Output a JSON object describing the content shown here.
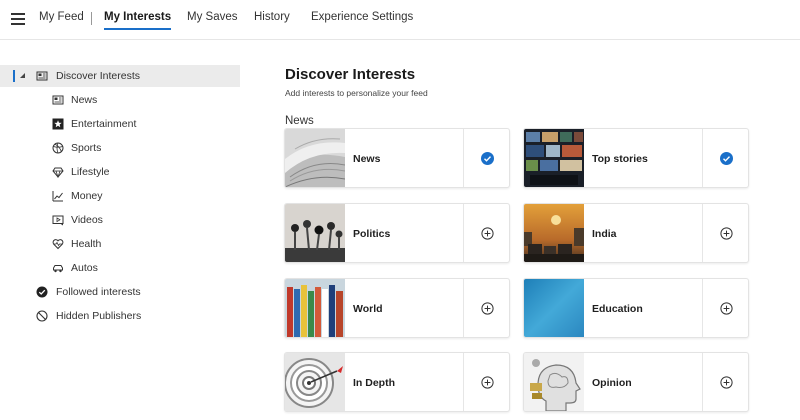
{
  "topnav": {
    "items": [
      {
        "label": "My Feed",
        "active": false
      },
      {
        "label": "My Interests",
        "active": true
      },
      {
        "label": "My Saves",
        "active": false
      },
      {
        "label": "History",
        "active": false
      },
      {
        "label": "Experience Settings",
        "active": false
      }
    ]
  },
  "sidebar": {
    "root": {
      "label": "Discover Interests",
      "icon": "newspaper-icon",
      "selected": true
    },
    "children": [
      {
        "label": "News",
        "icon": "newspaper-icon"
      },
      {
        "label": "Entertainment",
        "icon": "star-icon"
      },
      {
        "label": "Sports",
        "icon": "basketball-icon"
      },
      {
        "label": "Lifestyle",
        "icon": "diamond-icon"
      },
      {
        "label": "Money",
        "icon": "chart-icon"
      },
      {
        "label": "Videos",
        "icon": "video-icon"
      },
      {
        "label": "Health",
        "icon": "heart-icon"
      },
      {
        "label": "Autos",
        "icon": "car-icon"
      }
    ],
    "followed": {
      "label": "Followed interests",
      "icon": "check-circle-icon"
    },
    "hidden": {
      "label": "Hidden Publishers",
      "icon": "block-icon"
    }
  },
  "main": {
    "title": "Discover Interests",
    "subtitle": "Add interests to personalize your feed",
    "section": "News",
    "cards": [
      {
        "label": "News",
        "followed": true,
        "thumb": "newspapers"
      },
      {
        "label": "Top stories",
        "followed": true,
        "thumb": "screens"
      },
      {
        "label": "Politics",
        "followed": false,
        "thumb": "microphones"
      },
      {
        "label": "India",
        "followed": false,
        "thumb": "traffic"
      },
      {
        "label": "World",
        "followed": false,
        "thumb": "flags"
      },
      {
        "label": "Education",
        "followed": false,
        "thumb": "blue"
      },
      {
        "label": "In Depth",
        "followed": false,
        "thumb": "dartboard"
      },
      {
        "label": "Opinion",
        "followed": false,
        "thumb": "head"
      }
    ]
  },
  "colors": {
    "accent": "#1a6fc9",
    "selected_bg": "#ebebeb"
  }
}
